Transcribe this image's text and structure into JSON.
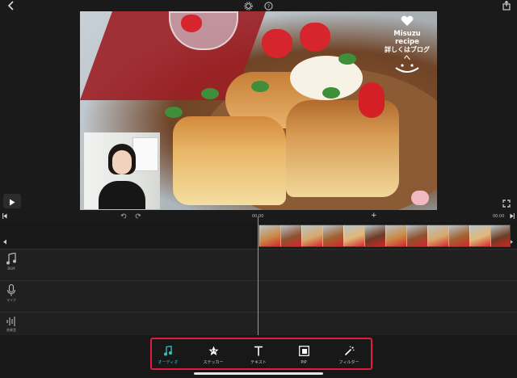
{
  "top_bar": {
    "back_icon": "chevron-left-icon",
    "settings_icon": "gear-icon",
    "help_icon": "question-icon",
    "share_icon": "share-icon"
  },
  "preview": {
    "logo_line1": "Misuzu recipe",
    "logo_line2": "詳しくはブログへ"
  },
  "timeline": {
    "ruler_start": "00:00",
    "ruler_mid": "00:00",
    "ruler_end": "00:00",
    "undo_icon": "undo-icon",
    "redo_icon": "redo-icon",
    "add_icon": "plus-icon",
    "tracks": {
      "bgm_label": "BGM",
      "mic_label": "マイク",
      "sfx_label": "効果音"
    }
  },
  "toolbar": {
    "tools": [
      {
        "label": "オーディオ",
        "icon": "music-note-icon",
        "color": "#2fc4c4"
      },
      {
        "label": "ステッカー",
        "icon": "sticker-icon",
        "color": "#ffffff"
      },
      {
        "label": "テキスト",
        "icon": "text-icon",
        "color": "#ffffff"
      },
      {
        "label": "PiP",
        "icon": "pip-icon",
        "color": "#ffffff"
      },
      {
        "label": "フィルター",
        "icon": "magic-wand-icon",
        "color": "#ffffff"
      }
    ],
    "highlight_color": "#e01b3c"
  }
}
